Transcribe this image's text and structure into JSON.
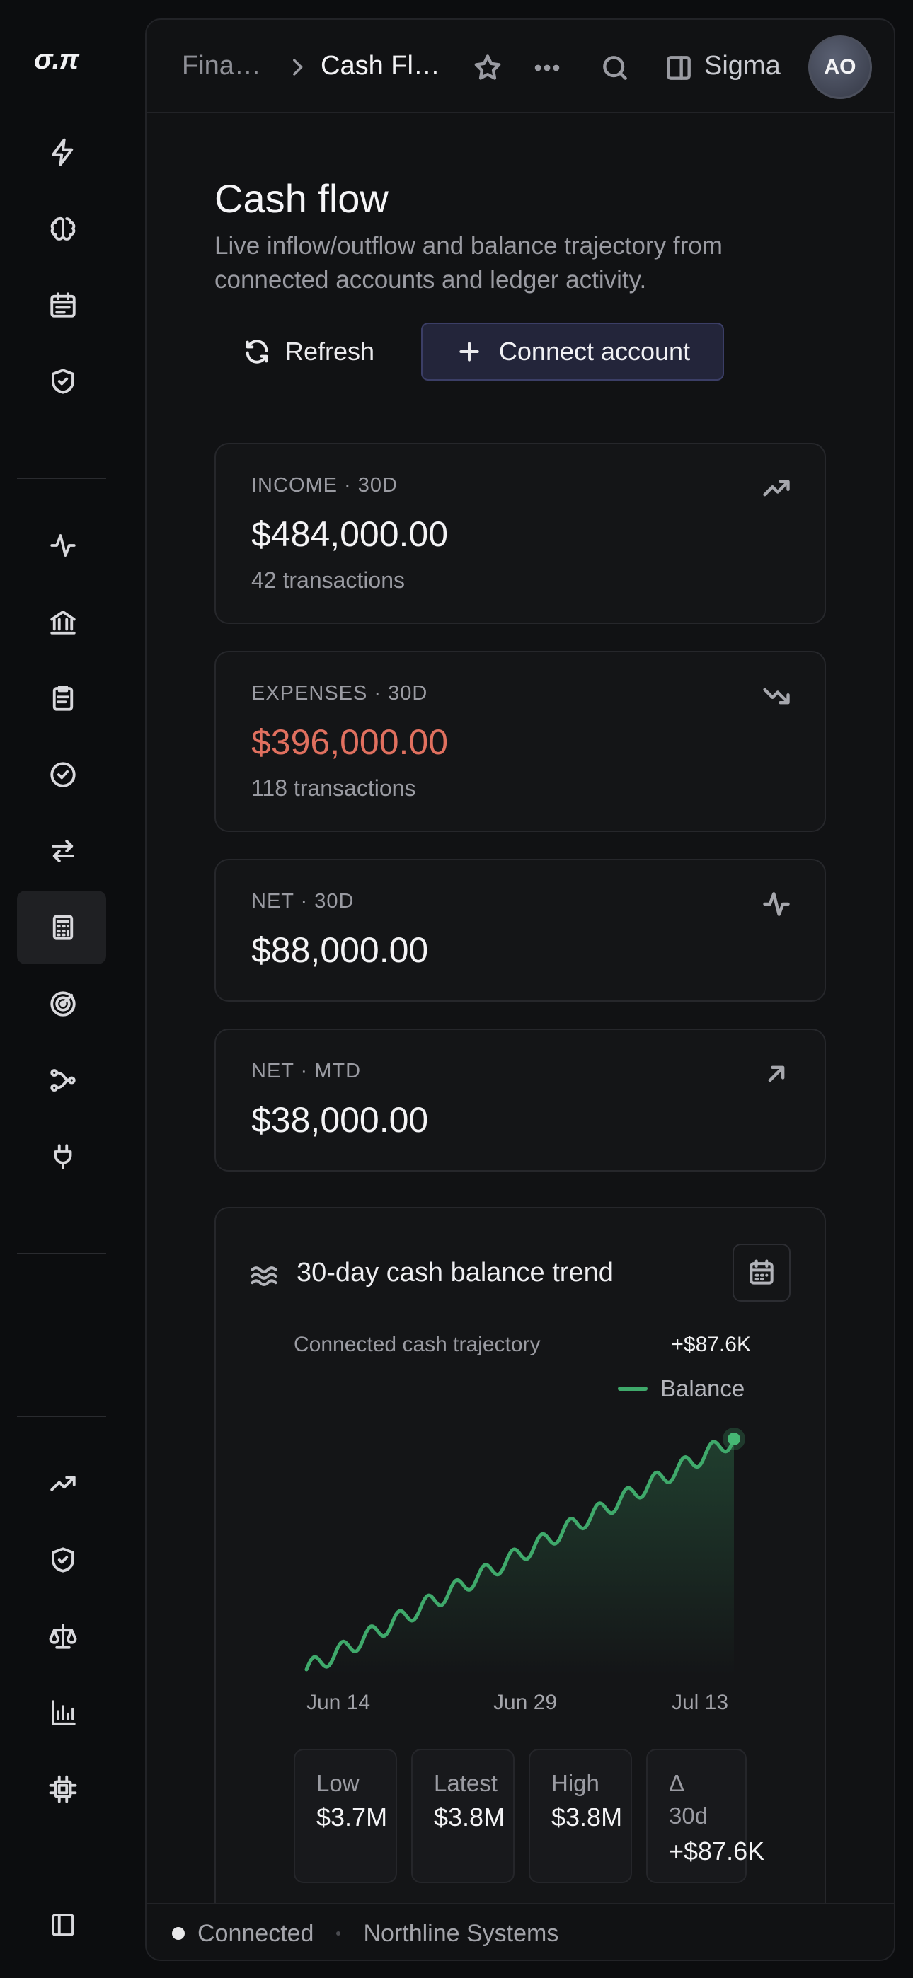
{
  "brand": {
    "logo_text": "σ.π"
  },
  "header": {
    "breadcrumb_parent": "Fina…",
    "breadcrumb_current": "Cash Fl…",
    "workspace": "Sigma",
    "avatar_initials": "AO"
  },
  "page": {
    "title": "Cash flow",
    "subtitle": "Live inflow/outflow and balance trajectory from connected accounts and ledger activity.",
    "refresh_label": "Refresh",
    "connect_label": "Connect account"
  },
  "stats": [
    {
      "label": "INCOME · 30D",
      "value": "$484,000.00",
      "meta": "42 transactions",
      "icon": "trending-up-icon",
      "negative": false
    },
    {
      "label": "EXPENSES · 30D",
      "value": "$396,000.00",
      "meta": "118 transactions",
      "icon": "trending-down-icon",
      "negative": true
    },
    {
      "label": "NET · 30D",
      "value": "$88,000.00",
      "meta": "",
      "icon": "activity-icon",
      "negative": false
    },
    {
      "label": "NET · MTD",
      "value": "$38,000.00",
      "meta": "",
      "icon": "arrow-up-right-icon",
      "negative": false
    }
  ],
  "chart": {
    "title": "30-day cash balance trend",
    "subtitle": "Connected cash trajectory",
    "delta": "+$87.6K",
    "legend": "Balance",
    "x_ticks": [
      "Jun 14",
      "Jun 29",
      "Jul 13"
    ],
    "summary": [
      {
        "label": "Low",
        "value": "$3.7M"
      },
      {
        "label": "Latest",
        "value": "$3.8M"
      },
      {
        "label": "High",
        "value": "$3.8M"
      },
      {
        "label": "Δ 30d",
        "value": "+$87.6K"
      }
    ]
  },
  "chart_data": {
    "type": "area",
    "title": "30-day cash balance trend",
    "series": [
      {
        "name": "Balance",
        "color": "#3fa96b"
      }
    ],
    "x_start": "Jun 14",
    "x_end": "Jul 13",
    "x_ticks": [
      "Jun 14",
      "Jun 29",
      "Jul 13"
    ],
    "y_low": 3700000,
    "y_high": 3800000,
    "delta": 87600,
    "grid": false,
    "legend_position": "top-right"
  },
  "status": {
    "connection": "Connected",
    "org": "Northline Systems"
  },
  "colors": {
    "accent": "#3fa96b",
    "negative": "#e0705f",
    "primary_btn": "#23253a"
  }
}
